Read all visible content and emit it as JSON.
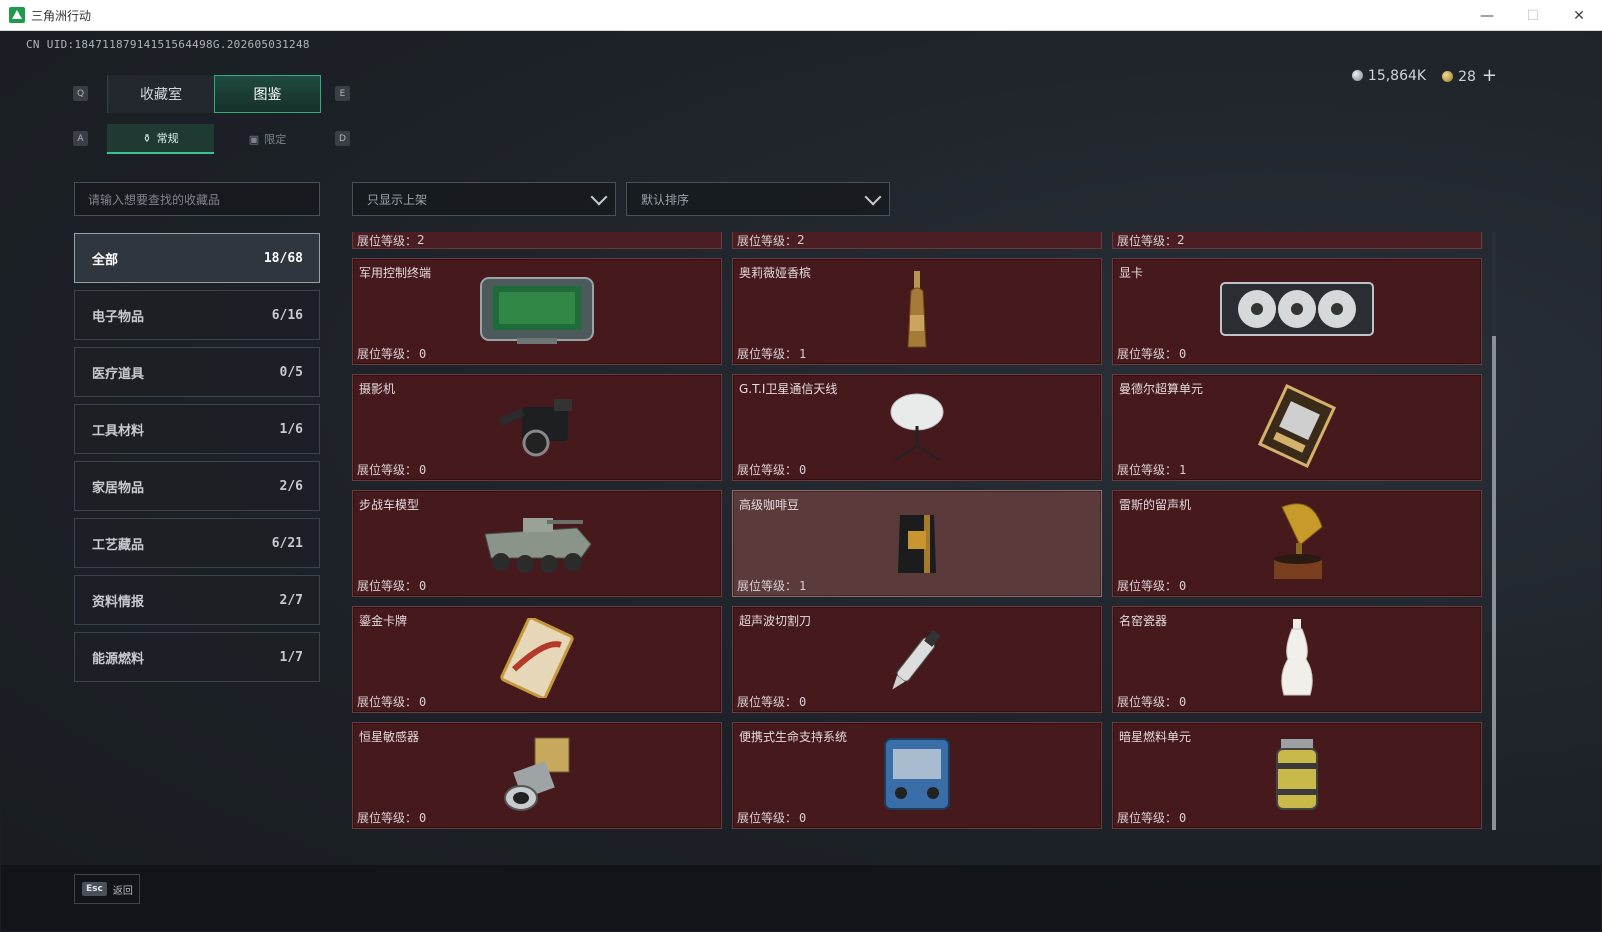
{
  "window": {
    "title": "三角洲行动",
    "minimize": "—",
    "maximize": "☐",
    "close": "✕"
  },
  "uid_text": "CN UID:18471187914151564498G.202605031248",
  "currency": {
    "silver_amount": "15,864K",
    "gold_amount": "28",
    "plus": "+"
  },
  "keys": {
    "q": "Q",
    "e": "E",
    "a": "A",
    "d": "D"
  },
  "main_tabs": [
    {
      "label": "收藏室"
    },
    {
      "label": "图鉴"
    }
  ],
  "sub_tabs": [
    {
      "label": "常规",
      "icon": "bottle-icon"
    },
    {
      "label": "限定",
      "icon": "image-icon"
    }
  ],
  "search": {
    "placeholder": "请输入想要查找的收藏品"
  },
  "filters": {
    "shelf_filter": "只显示上架",
    "sort": "默认排序"
  },
  "categories": [
    {
      "label": "全部",
      "count": "18/68"
    },
    {
      "label": "电子物品",
      "count": "6/16"
    },
    {
      "label": "医疗道具",
      "count": "0/5"
    },
    {
      "label": "工具材料",
      "count": "1/6"
    },
    {
      "label": "家居物品",
      "count": "2/6"
    },
    {
      "label": "工艺藏品",
      "count": "6/21"
    },
    {
      "label": "资料情报",
      "count": "2/7"
    },
    {
      "label": "能源燃料",
      "count": "1/7"
    }
  ],
  "level_label": "展位等级：",
  "partial_row": [
    "2",
    "2",
    "2"
  ],
  "items": [
    {
      "name": "军用控制终端",
      "level": "0",
      "icon": "military-tablet-icon"
    },
    {
      "name": "奥莉薇娅香槟",
      "level": "1",
      "icon": "champagne-bottle-icon"
    },
    {
      "name": "显卡",
      "level": "0",
      "icon": "graphics-card-icon"
    },
    {
      "name": "摄影机",
      "level": "0",
      "icon": "video-camera-icon"
    },
    {
      "name": "G.T.I卫星通信天线",
      "level": "0",
      "icon": "satellite-dish-icon"
    },
    {
      "name": "曼德尔超算单元",
      "level": "1",
      "icon": "supercomputer-chip-icon"
    },
    {
      "name": "步战车模型",
      "level": "0",
      "icon": "ifv-model-icon"
    },
    {
      "name": "高级咖啡豆",
      "level": "1",
      "icon": "coffee-bag-icon"
    },
    {
      "name": "雷斯的留声机",
      "level": "0",
      "icon": "gramophone-icon"
    },
    {
      "name": "鎏金卡牌",
      "level": "0",
      "icon": "gilded-card-icon"
    },
    {
      "name": "超声波切割刀",
      "level": "0",
      "icon": "ultrasonic-cutter-icon"
    },
    {
      "name": "名窑瓷器",
      "level": "0",
      "icon": "porcelain-vase-icon"
    },
    {
      "name": "恒星敏感器",
      "level": "0",
      "icon": "star-sensor-icon"
    },
    {
      "name": "便携式生命支持系统",
      "level": "0",
      "icon": "life-support-icon"
    },
    {
      "name": "暗星燃料单元",
      "level": "0",
      "icon": "fuel-cell-icon"
    }
  ],
  "footer": {
    "esc_key": "Esc",
    "back_label": "返回"
  }
}
